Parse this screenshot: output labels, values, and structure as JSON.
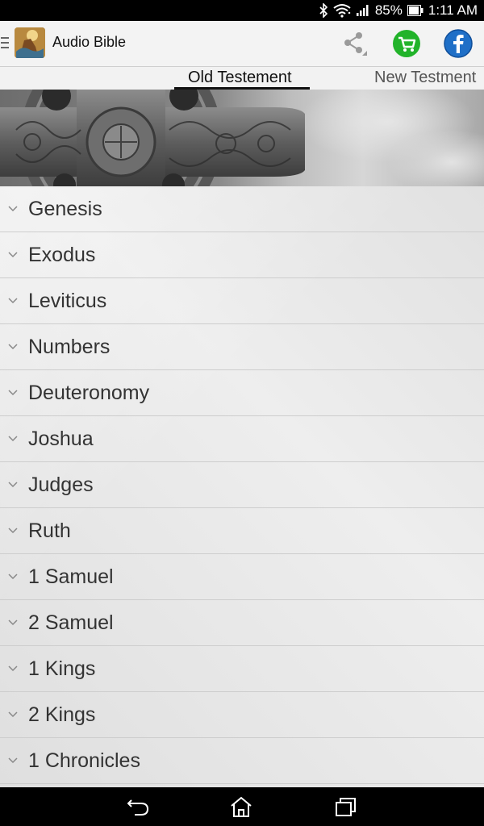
{
  "status_bar": {
    "battery_percent": "85%",
    "time": "1:11 AM",
    "icons": [
      "bluetooth-icon",
      "wifi-icon",
      "signal-icon",
      "battery-icon"
    ]
  },
  "app_bar": {
    "title": "Audio Bible",
    "icons": [
      "menu-icon",
      "share-icon",
      "cart-icon",
      "facebook-icon"
    ],
    "colors": {
      "cart": "#22b32a",
      "facebook": "#1f6fc7"
    }
  },
  "tabs": [
    {
      "label": "Old Testement",
      "selected": true
    },
    {
      "label": "New Testment",
      "selected": false
    }
  ],
  "books": [
    {
      "label": "Genesis"
    },
    {
      "label": "Exodus"
    },
    {
      "label": "Leviticus"
    },
    {
      "label": "Numbers"
    },
    {
      "label": "Deuteronomy"
    },
    {
      "label": "Joshua"
    },
    {
      "label": "Judges"
    },
    {
      "label": "Ruth"
    },
    {
      "label": "1 Samuel"
    },
    {
      "label": "2 Samuel"
    },
    {
      "label": "1 Kings"
    },
    {
      "label": "2 Kings"
    },
    {
      "label": "1 Chronicles"
    }
  ],
  "nav_bar": {
    "icons": [
      "back-icon",
      "home-icon",
      "recent-apps-icon"
    ]
  }
}
